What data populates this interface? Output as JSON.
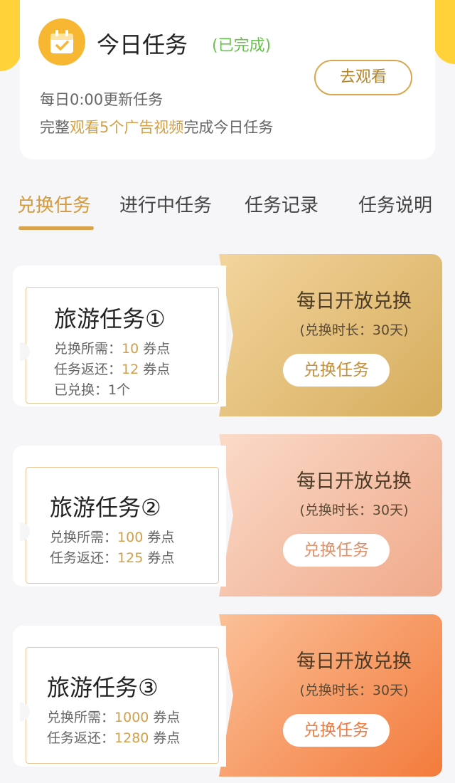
{
  "daily": {
    "title": "今日任务",
    "status": "(已完成)",
    "watch_button": "去观看",
    "line1": "每日0:00更新任务",
    "line2_prefix": "完整",
    "line2_highlight": "观看5个广告视频",
    "line2_suffix": "完成今日任务",
    "icon": "calendar-check-icon"
  },
  "tabs": [
    {
      "label": "兑换任务",
      "active": true
    },
    {
      "label": "进行中任务",
      "active": false
    },
    {
      "label": "任务记录",
      "active": false
    },
    {
      "label": "任务说明",
      "active": false
    }
  ],
  "tasks": [
    {
      "title": "旅游任务①",
      "need_label": "兑换所需：",
      "need_value": "10",
      "need_unit": "券点",
      "return_label": "任务返还：",
      "return_value": "12",
      "return_unit": "券点",
      "exchanged": "已兑换：1个",
      "open_text": "每日开放兑换",
      "duration": "(兑换时长：30天)",
      "button": "兑换任务"
    },
    {
      "title": "旅游任务②",
      "need_label": "兑换所需：",
      "need_value": "100",
      "need_unit": "券点",
      "return_label": "任务返还：",
      "return_value": "125",
      "return_unit": "券点",
      "open_text": "每日开放兑换",
      "duration": "(兑换时长：30天)",
      "button": "兑换任务"
    },
    {
      "title": "旅游任务③",
      "need_label": "兑换所需：",
      "need_value": "1000",
      "need_unit": "券点",
      "return_label": "任务返还：",
      "return_value": "1280",
      "return_unit": "券点",
      "open_text": "每日开放兑换",
      "duration": "(兑换时长：30天)",
      "button": "兑换任务"
    }
  ],
  "colors": {
    "accent": "#d29a3d",
    "success": "#6ac24f",
    "highlight": "#d2a04a"
  }
}
